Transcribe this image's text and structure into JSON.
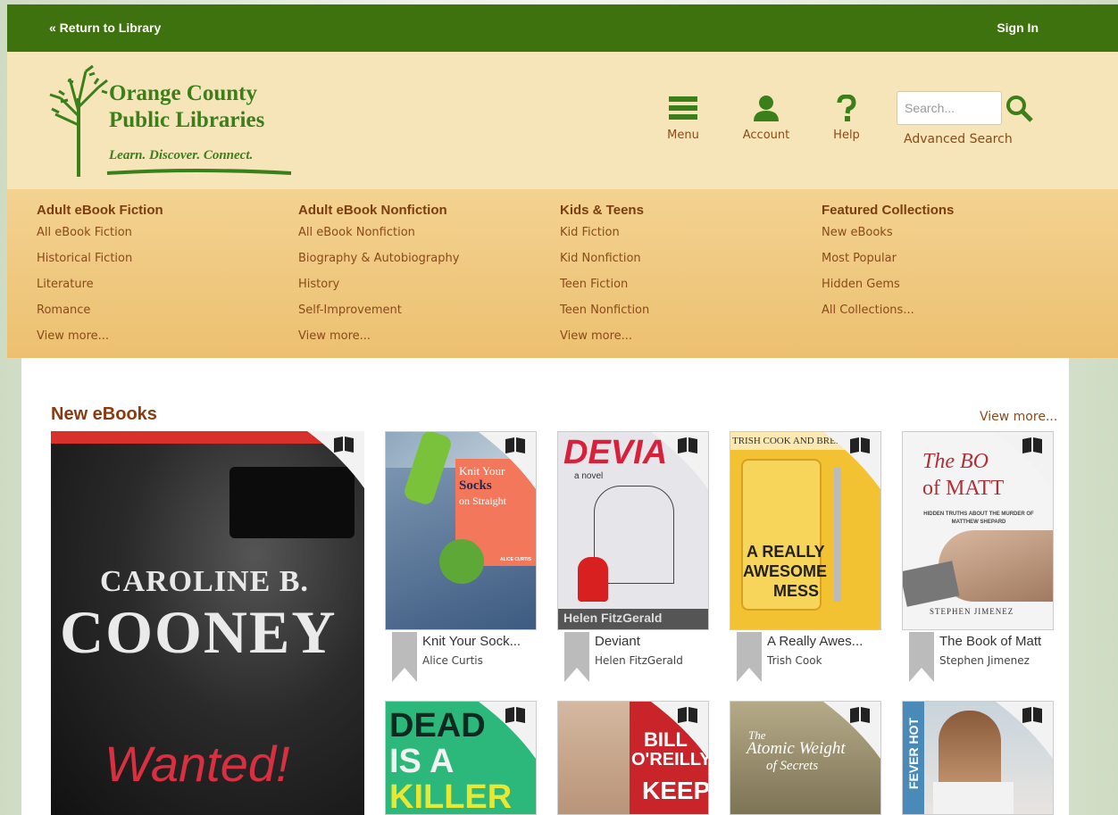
{
  "topbar": {
    "return_label": "« Return to Library",
    "signin_label": "Sign In"
  },
  "logo": {
    "line1": "Orange County",
    "line2": "Public Libraries",
    "tagline": "Learn. Discover. Connect."
  },
  "nav": {
    "menu_label": "Menu",
    "account_label": "Account",
    "help_label": "Help"
  },
  "search": {
    "placeholder": "Search...",
    "advanced_label": "Advanced Search"
  },
  "menu": {
    "columns": [
      {
        "heading": "Adult eBook Fiction",
        "items": [
          "All eBook Fiction",
          "Historical Fiction",
          "Literature",
          "Romance",
          "View more..."
        ]
      },
      {
        "heading": "Adult eBook Nonfiction",
        "items": [
          "All eBook Nonfiction",
          "Biography & Autobiography",
          "History",
          "Self-Improvement",
          "View more..."
        ]
      },
      {
        "heading": "Kids & Teens",
        "items": [
          "Kid Fiction",
          "Kid Nonfiction",
          "Teen Fiction",
          "Teen Nonfiction",
          "View more..."
        ]
      },
      {
        "heading": "Featured Collections",
        "items": [
          "New eBooks",
          "Most Popular",
          "Hidden Gems",
          "All Collections..."
        ]
      }
    ]
  },
  "section": {
    "title": "New eBooks",
    "view_more": "View more..."
  },
  "featured": {
    "author": "CAROLINE B.",
    "surname": "COONEY",
    "title": "Wanted!"
  },
  "books": [
    {
      "title": "Knit Your Sock...",
      "author": "Alice Curtis",
      "cover_line1": "Knit Your",
      "cover_line2": "Socks",
      "cover_line3": "on Straight",
      "cover_author": "ALICE CURTIS"
    },
    {
      "title": "Deviant",
      "author": "Helen FitzGerald",
      "cover_line1": "DEVIA",
      "cover_line2": "a novel",
      "cover_author": "Helen FitzGerald"
    },
    {
      "title": "A Really Awes...",
      "author": "Trish Cook",
      "cover_line1": "TRISH COOK AND BREN",
      "cover_line2": "A REALLY",
      "cover_line3": "AWESOME",
      "cover_line4": "MESS"
    },
    {
      "title": "The Book of Matt",
      "author": "Stephen Jimenez",
      "cover_line1": "The BO",
      "cover_line2": "of MATT",
      "cover_line3": "HIDDEN TRUTHS ABOUT THE MURDER OF MATTHEW SHEPARD",
      "cover_author": "STEPHEN JIMENEZ"
    }
  ],
  "books_row2": [
    {
      "cover_line1": "DEAD",
      "cover_line2": "IS A",
      "cover_line3": "KILLER"
    },
    {
      "cover_line1": "BILL",
      "cover_line2": "O'REILLY",
      "cover_line3": "KEEP"
    },
    {
      "cover_line1": "The",
      "cover_line2": "Atomic Weight",
      "cover_line3": "of Secrets"
    },
    {
      "cover_line1": "FEVER HOT"
    }
  ],
  "colors": {
    "topbar": "#3e720e",
    "header": "#f6e5b8",
    "menu": "#ecc070",
    "accent": "#8a3a10"
  }
}
